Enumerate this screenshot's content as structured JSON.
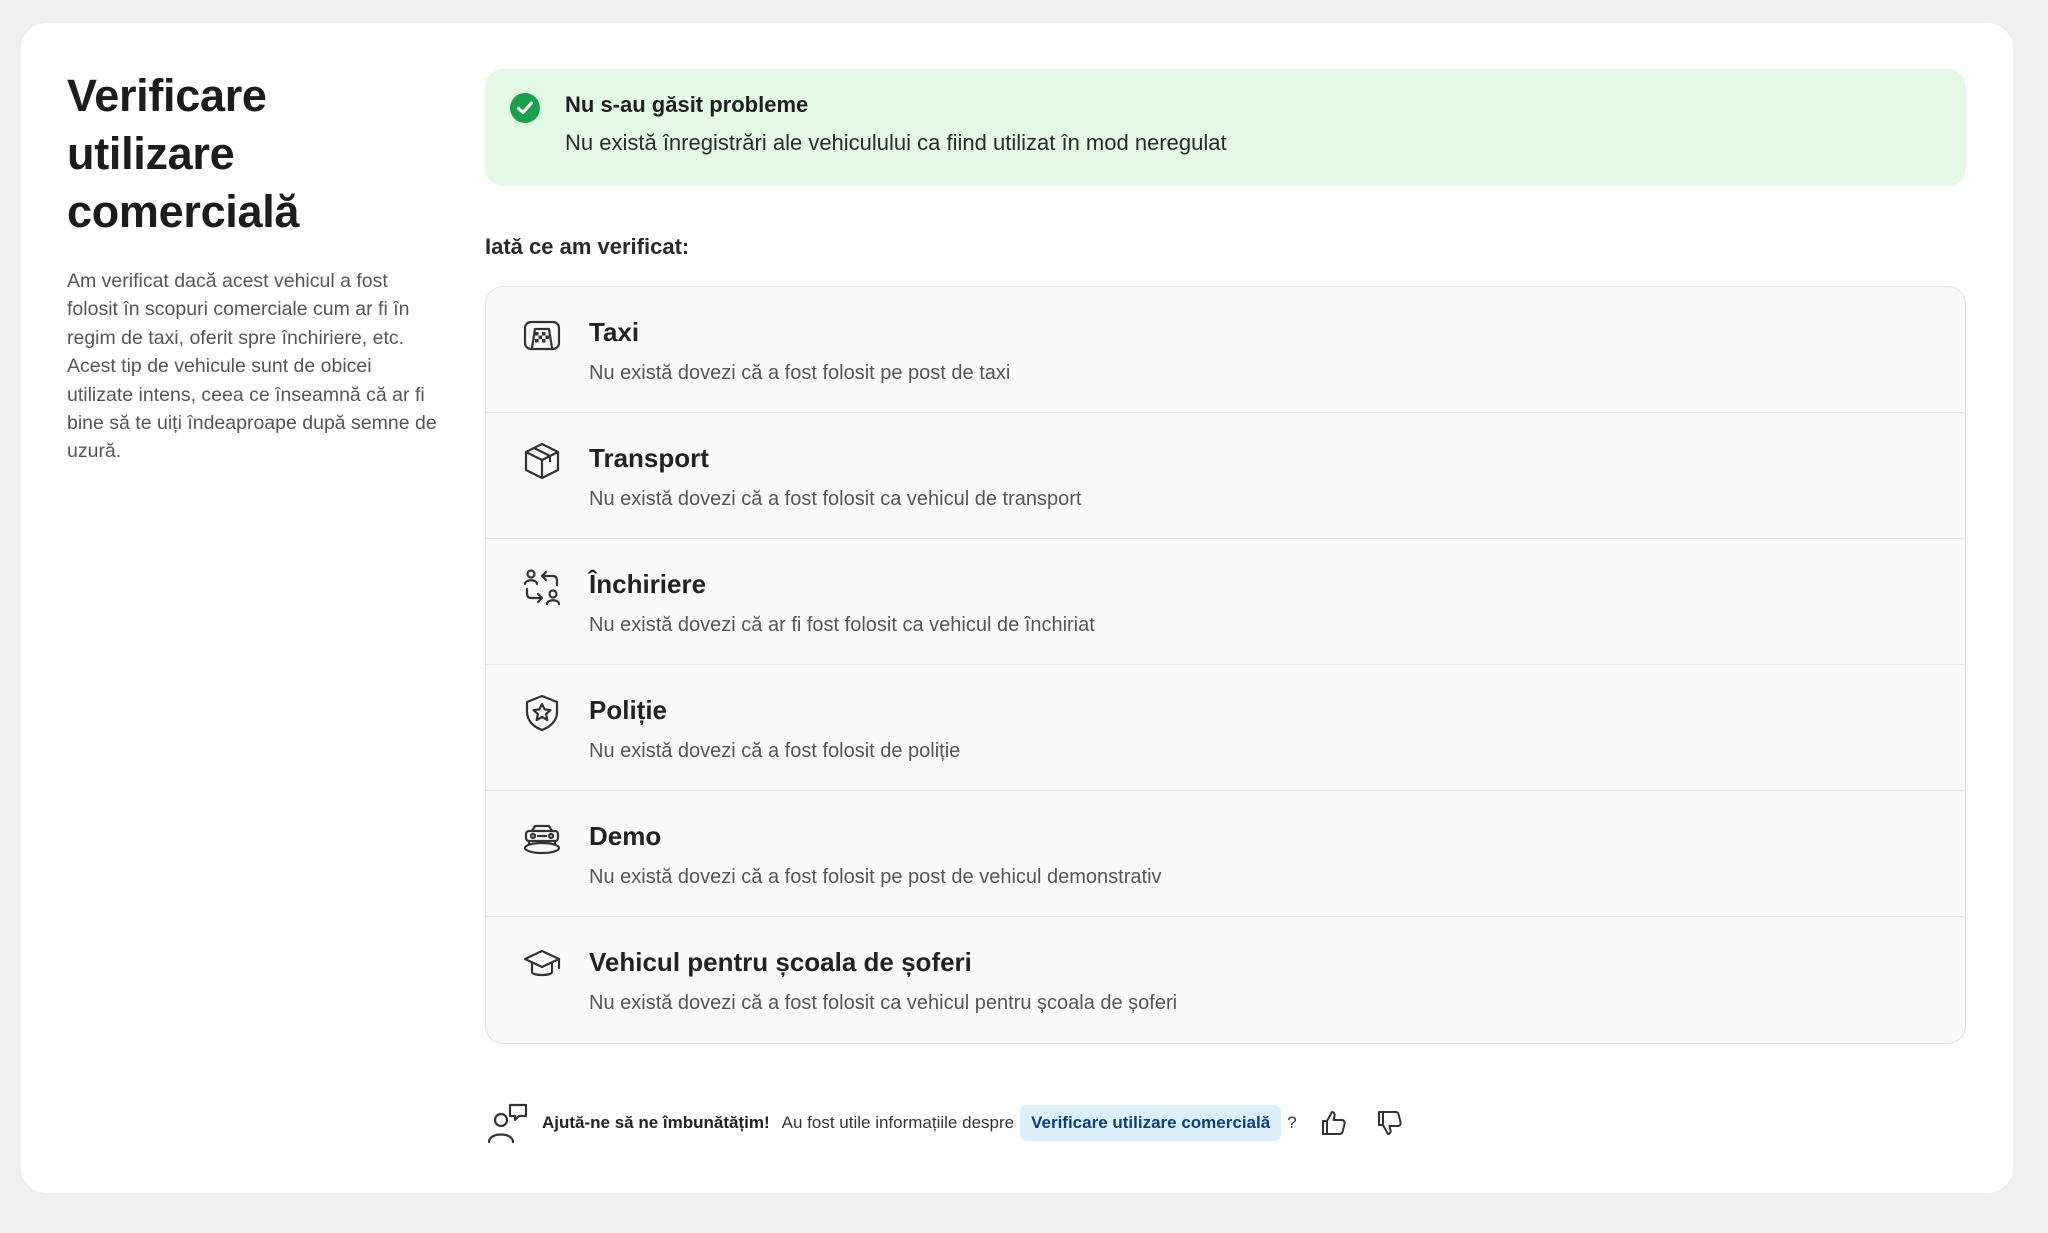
{
  "page": {
    "title": "Verificare utilizare comercială",
    "title_lines": [
      "Verificare",
      "utilizare",
      "comercială"
    ],
    "description": "Am verificat dacă acest vehicul a fost folosit în scopuri comerciale cum ar fi în regim de taxi, oferit spre închiriere, etc. Acest tip de vehicule sunt de obicei utilizate intens, ceea ce înseamnă că ar fi bine să te uiți îndeaproape după semne de uzură."
  },
  "result": {
    "title": "Nu s-au găsit probleme",
    "text": "Nu există înregistrări ale vehiculului ca fiind utilizat în mod neregulat",
    "color": "#1aa04b"
  },
  "checks_heading": "Iată ce am verificat:",
  "checks": [
    {
      "icon": "taxi-icon",
      "title": "Taxi",
      "desc": "Nu există dovezi că a fost folosit pe post de taxi"
    },
    {
      "icon": "box-icon",
      "title": "Transport",
      "desc": "Nu există dovezi că a fost folosit ca vehicul de transport"
    },
    {
      "icon": "rental-exchange-icon",
      "title": "Închiriere",
      "desc": "Nu există dovezi că ar fi fost folosit ca vehicul de închiriat"
    },
    {
      "icon": "police-badge-icon",
      "title": "Poliție",
      "desc": "Nu există dovezi că a fost folosit de poliție"
    },
    {
      "icon": "demo-car-icon",
      "title": "Demo",
      "desc": "Nu există dovezi că a fost folosit pe post de vehicul demonstrativ"
    },
    {
      "icon": "graduation-cap-icon",
      "title": "Vehicul pentru școala de șoferi",
      "desc": "Nu există dovezi că a fost folosit ca vehicul pentru școala de șoferi"
    }
  ],
  "feedback": {
    "prompt_bold": "Ajută-ne să ne îmbunătățim!",
    "prompt_text": "Au fost utile informațiile despre",
    "chip": "Verificare utilizare comercială",
    "question_mark": "?"
  }
}
